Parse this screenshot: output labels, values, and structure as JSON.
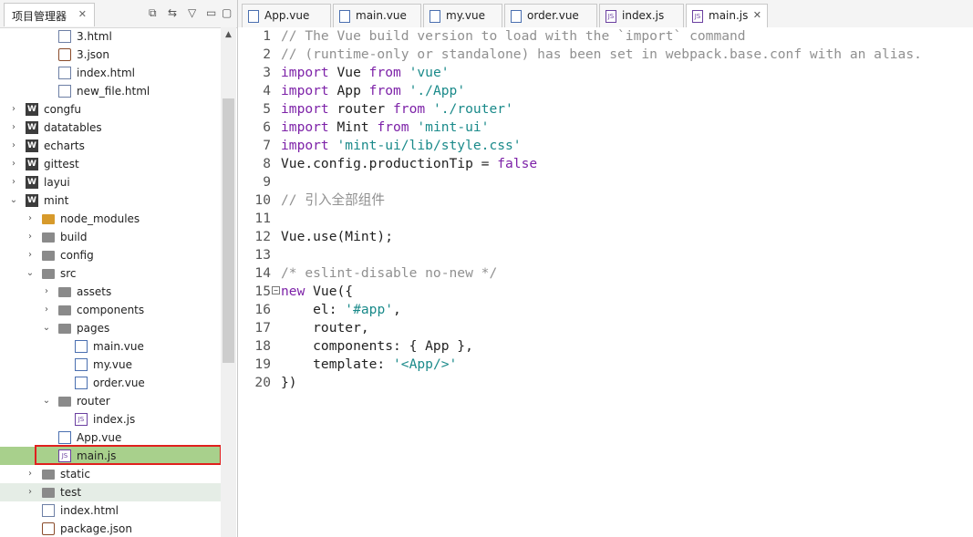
{
  "explorer": {
    "tab_label": "项目管理器",
    "tab_close": "✕",
    "controls": [
      "⧉",
      "⇆",
      "▽",
      "▭",
      "▢"
    ],
    "scroll_up": "▲",
    "tree": [
      {
        "label": "3.html",
        "level": 2,
        "icon": "html",
        "twisty": ""
      },
      {
        "label": "3.json",
        "level": 2,
        "icon": "json",
        "twisty": ""
      },
      {
        "label": "index.html",
        "level": 2,
        "icon": "html",
        "twisty": ""
      },
      {
        "label": "new_file.html",
        "level": 2,
        "icon": "html",
        "twisty": ""
      },
      {
        "label": "congfu",
        "level": 0,
        "icon": "project",
        "twisty": "›"
      },
      {
        "label": "datatables",
        "level": 0,
        "icon": "project",
        "twisty": "›"
      },
      {
        "label": "echarts",
        "level": 0,
        "icon": "project",
        "twisty": "›"
      },
      {
        "label": "gittest",
        "level": 0,
        "icon": "project",
        "twisty": "›"
      },
      {
        "label": "layui",
        "level": 0,
        "icon": "project",
        "twisty": "›"
      },
      {
        "label": "mint",
        "level": 0,
        "icon": "project",
        "twisty": "⌄"
      },
      {
        "label": "node_modules",
        "level": 1,
        "icon": "node",
        "twisty": "›"
      },
      {
        "label": "build",
        "level": 1,
        "icon": "folder",
        "twisty": "›"
      },
      {
        "label": "config",
        "level": 1,
        "icon": "folder",
        "twisty": "›"
      },
      {
        "label": "src",
        "level": 1,
        "icon": "folder",
        "twisty": "⌄"
      },
      {
        "label": "assets",
        "level": 2,
        "icon": "folder",
        "twisty": "›"
      },
      {
        "label": "components",
        "level": 2,
        "icon": "folder",
        "twisty": "›"
      },
      {
        "label": "pages",
        "level": 2,
        "icon": "folder",
        "twisty": "⌄"
      },
      {
        "label": "main.vue",
        "level": 3,
        "icon": "vue",
        "twisty": ""
      },
      {
        "label": "my.vue",
        "level": 3,
        "icon": "vue",
        "twisty": ""
      },
      {
        "label": "order.vue",
        "level": 3,
        "icon": "vue",
        "twisty": ""
      },
      {
        "label": "router",
        "level": 2,
        "icon": "folder",
        "twisty": "⌄"
      },
      {
        "label": "index.js",
        "level": 3,
        "icon": "js",
        "twisty": ""
      },
      {
        "label": "App.vue",
        "level": 2,
        "icon": "vue",
        "twisty": ""
      },
      {
        "label": "main.js",
        "level": 2,
        "icon": "js",
        "twisty": "",
        "state": "selected"
      },
      {
        "label": "static",
        "level": 1,
        "icon": "folder",
        "twisty": "›"
      },
      {
        "label": "test",
        "level": 1,
        "icon": "folder",
        "twisty": "›",
        "state": "hover"
      },
      {
        "label": "index.html",
        "level": 1,
        "icon": "html",
        "twisty": ""
      },
      {
        "label": "package.json",
        "level": 1,
        "icon": "json",
        "twisty": ""
      }
    ]
  },
  "editor": {
    "tabs": [
      {
        "label": "App.vue",
        "icon": "vue"
      },
      {
        "label": "main.vue",
        "icon": "vue"
      },
      {
        "label": "my.vue",
        "icon": "vue"
      },
      {
        "label": "order.vue",
        "icon": "vue"
      },
      {
        "label": "index.js",
        "icon": "js"
      },
      {
        "label": "main.js",
        "icon": "js",
        "active": true,
        "close": "✕"
      }
    ],
    "fold_marker": "−",
    "lines": [
      [
        [
          "cm",
          "// The Vue build version to load with the `import` command"
        ]
      ],
      [
        [
          "cm",
          "// (runtime-only or standalone) has been set in webpack.base.conf with an alias."
        ]
      ],
      [
        [
          "kw",
          "import"
        ],
        [
          "pl",
          " Vue "
        ],
        [
          "kw",
          "from"
        ],
        [
          "pl",
          " "
        ],
        [
          "str",
          "'vue'"
        ]
      ],
      [
        [
          "kw",
          "import"
        ],
        [
          "pl",
          " App "
        ],
        [
          "kw",
          "from"
        ],
        [
          "pl",
          " "
        ],
        [
          "str",
          "'./App'"
        ]
      ],
      [
        [
          "kw",
          "import"
        ],
        [
          "pl",
          " router "
        ],
        [
          "kw",
          "from"
        ],
        [
          "pl",
          " "
        ],
        [
          "str",
          "'./router'"
        ]
      ],
      [
        [
          "kw",
          "import"
        ],
        [
          "pl",
          " Mint "
        ],
        [
          "kw",
          "from"
        ],
        [
          "pl",
          " "
        ],
        [
          "str",
          "'mint-ui'"
        ]
      ],
      [
        [
          "kw",
          "import"
        ],
        [
          "pl",
          " "
        ],
        [
          "str",
          "'mint-ui/lib/style.css'"
        ]
      ],
      [
        [
          "pl",
          "Vue.config.productionTip = "
        ],
        [
          "kw",
          "false"
        ]
      ],
      [],
      [
        [
          "cm",
          "// 引入全部组件"
        ]
      ],
      [],
      [
        [
          "pl",
          "Vue.use(Mint);"
        ]
      ],
      [],
      [
        [
          "cm",
          "/* eslint-disable no-new */"
        ]
      ],
      [
        [
          "kw",
          "new"
        ],
        [
          "pl",
          " Vue({"
        ]
      ],
      [
        [
          "pl",
          "    el: "
        ],
        [
          "str",
          "'#app'"
        ],
        [
          "pl",
          ","
        ]
      ],
      [
        [
          "pl",
          "    router,"
        ]
      ],
      [
        [
          "pl",
          "    components: { App },"
        ]
      ],
      [
        [
          "pl",
          "    template: "
        ],
        [
          "str",
          "'<App/>'"
        ]
      ],
      [
        [
          "pl",
          "})"
        ]
      ]
    ]
  }
}
